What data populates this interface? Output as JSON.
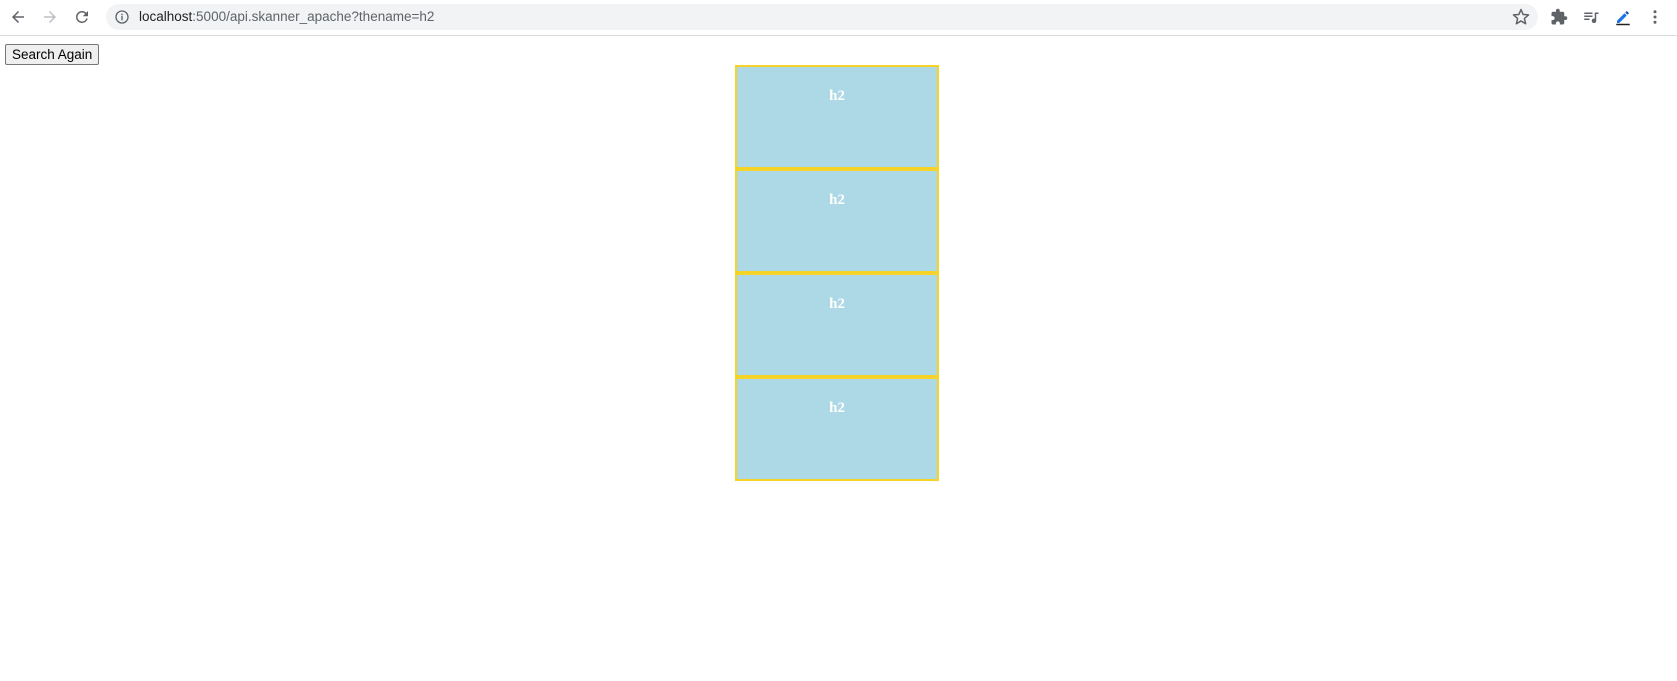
{
  "browser": {
    "url_host": "localhost",
    "url_rest": ":5000/api.skanner_apache?thename=h2",
    "icons": {
      "back": "arrow-left-icon",
      "forward": "arrow-right-icon",
      "reload": "reload-icon",
      "info": "info-icon",
      "bookmark": "star-icon",
      "extensions": "puzzle-icon",
      "media": "media-queue-icon",
      "extension_pen": "pen-extension-icon",
      "menu": "kebab-menu-icon"
    }
  },
  "page": {
    "search_again_label": "Search Again",
    "cards": [
      {
        "title": "h2"
      },
      {
        "title": "h2"
      },
      {
        "title": "h2"
      },
      {
        "title": "h2"
      }
    ],
    "colors": {
      "card_bg": "#add8e6",
      "card_border": "#f5d327",
      "card_text": "#ffffff"
    }
  }
}
